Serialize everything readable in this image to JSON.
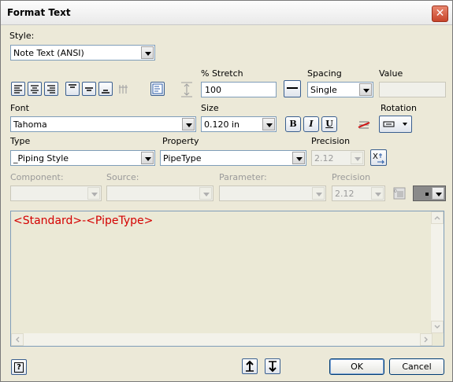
{
  "window": {
    "title": "Format Text",
    "close_glyph": "✕"
  },
  "style": {
    "label": "Style:",
    "value": "Note Text (ANSI)"
  },
  "stretch": {
    "label": "% Stretch",
    "value": "100"
  },
  "spacing": {
    "label": "Spacing",
    "value": "Single"
  },
  "value": {
    "label": "Value",
    "value": ""
  },
  "font": {
    "label": "Font",
    "value": "Tahoma"
  },
  "size": {
    "label": "Size",
    "value": "0.120 in"
  },
  "format_buttons": {
    "bold": "B",
    "italic": "I",
    "underline": "U"
  },
  "rotation": {
    "label": "Rotation"
  },
  "type": {
    "label": "Type",
    "value": "_Piping Style"
  },
  "property": {
    "label": "Property",
    "value": "PipeType"
  },
  "precision1": {
    "label": "Precision",
    "value": "2.12"
  },
  "component": {
    "label": "Component:",
    "value": ""
  },
  "source": {
    "label": "Source:",
    "value": ""
  },
  "parameter": {
    "label": "Parameter:",
    "value": ""
  },
  "precision2": {
    "label": "Precision",
    "value": "2.12"
  },
  "editor": {
    "text": "<Standard>-<PipeType>",
    "text_color": "#d40000",
    "background": "#ebe9d6"
  },
  "footer": {
    "help_label": "?",
    "ok_label": "OK",
    "cancel_label": "Cancel"
  },
  "icons": [
    "align-left-icon",
    "align-center-icon",
    "align-right-icon",
    "valign-top-icon",
    "valign-middle-icon",
    "valign-bottom-icon",
    "grid-icon",
    "text-frame-icon",
    "fit-icon",
    "line-spacing-icon",
    "strikethrough-icon",
    "rotation-icon",
    "insert-parameter-icon",
    "symbol-icon",
    "color-icon",
    "move-up-icon",
    "move-down-icon",
    "help-icon"
  ]
}
